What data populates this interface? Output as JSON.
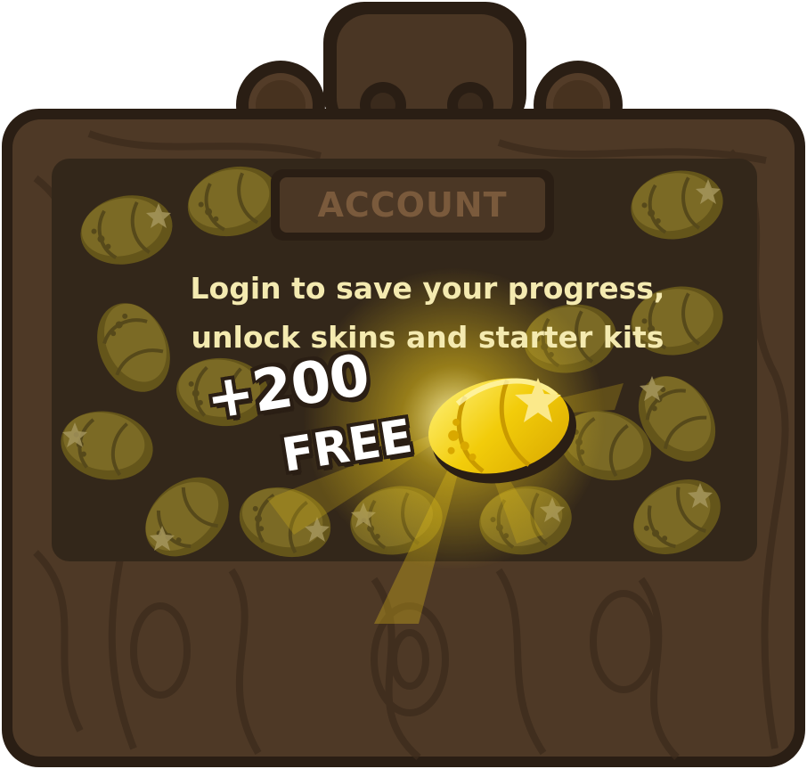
{
  "panel": {
    "title": "ACCOUNT",
    "message_line1": "Login to save your progress,",
    "message_line2": "unlock skins and starter kits"
  },
  "bonus": {
    "amount": "+200",
    "label": "FREE"
  },
  "colors": {
    "wood_dark": "#3a2a1c",
    "wood_mid": "#533c28",
    "wood_grain": "#47321f",
    "inner_panel": "#382a1b",
    "outline": "#2a1e14",
    "title_text": "#7a5a3c",
    "title_plank": "#4b3725",
    "message_text": "#f4eab0",
    "coin_gold": "#f2cc0a",
    "coin_dim": "#7a6a1e",
    "star": "#fbe98a"
  },
  "icons": {
    "coin": "gold-coin-icon",
    "star": "sparkle-star-icon"
  }
}
